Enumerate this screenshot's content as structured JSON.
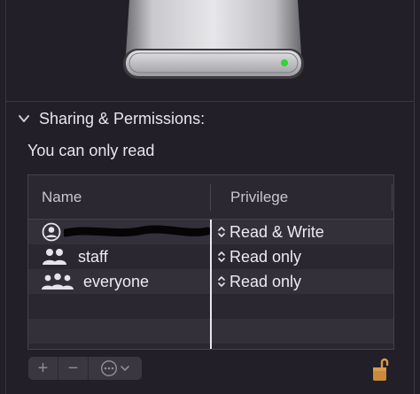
{
  "section": {
    "title": "Sharing & Permissions:",
    "note": "You can only read"
  },
  "table": {
    "columns": [
      "Name",
      "Privilege"
    ],
    "rows": [
      {
        "name": "",
        "privilege": "Read & Write",
        "icon": "user-circle-icon",
        "redacted": true
      },
      {
        "name": "staff",
        "privilege": "Read only",
        "icon": "group-icon"
      },
      {
        "name": "everyone",
        "privilege": "Read only",
        "icon": "everyone-icon"
      }
    ]
  },
  "controls": {
    "add": "+",
    "remove": "−"
  },
  "colors": {
    "drive_led": "#35d23a",
    "lock": "#c98a3c"
  }
}
